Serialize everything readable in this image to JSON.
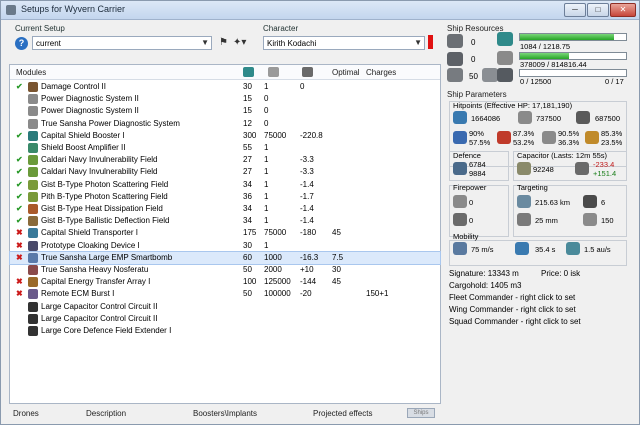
{
  "window": {
    "title": "Setups for Wyvern Carrier",
    "min": "─",
    "max": "□",
    "close": "✕"
  },
  "setup": {
    "label": "Current Setup",
    "value": "current"
  },
  "character": {
    "label": "Character",
    "value": "Kirith Kodachi"
  },
  "modules": {
    "headers": {
      "name": "Modules",
      "optimal": "Optimal",
      "charges": "Charges"
    },
    "rows": [
      {
        "state": "on",
        "name": "Damage Control II",
        "c1": "30",
        "c2": "1",
        "c3": "0",
        "c4": "",
        "c5": "",
        "icon": "#7a5530"
      },
      {
        "state": "",
        "name": "Power Diagnostic System II",
        "c1": "15",
        "c2": "0",
        "c3": "",
        "c4": "",
        "c5": "",
        "icon": "#8a8a8a"
      },
      {
        "state": "",
        "name": "Power Diagnostic System II",
        "c1": "15",
        "c2": "0",
        "c3": "",
        "c4": "",
        "c5": "",
        "icon": "#8a8a8a"
      },
      {
        "state": "",
        "name": "True Sansha Power Diagnostic System",
        "c1": "12",
        "c2": "0",
        "c3": "",
        "c4": "",
        "c5": "",
        "icon": "#8a8a8a"
      },
      {
        "state": "on",
        "name": "Capital Shield Booster I",
        "c1": "300",
        "c2": "75000",
        "c3": "-220.8",
        "c4": "",
        "c5": "",
        "icon": "#2a7a7a"
      },
      {
        "state": "",
        "name": "Shield Boost Amplifier II",
        "c1": "55",
        "c2": "1",
        "c3": "",
        "c4": "",
        "c5": "",
        "icon": "#3a8a6a"
      },
      {
        "state": "on",
        "name": "Caldari Navy Invulnerability Field",
        "c1": "27",
        "c2": "1",
        "c3": "-3.3",
        "c4": "",
        "c5": "",
        "icon": "#6a9a3a"
      },
      {
        "state": "on",
        "name": "Caldari Navy Invulnerability Field",
        "c1": "27",
        "c2": "1",
        "c3": "-3.3",
        "c4": "",
        "c5": "",
        "icon": "#6a9a3a"
      },
      {
        "state": "on",
        "name": "Gist B-Type Photon Scattering Field",
        "c1": "34",
        "c2": "1",
        "c3": "-1.4",
        "c4": "",
        "c5": "",
        "icon": "#7a9a3a"
      },
      {
        "state": "on",
        "name": "Pith B-Type Photon Scattering Field",
        "c1": "36",
        "c2": "1",
        "c3": "-1.7",
        "c4": "",
        "c5": "",
        "icon": "#7a9a3a"
      },
      {
        "state": "on",
        "name": "Gist B-Type Heat Dissipation Field",
        "c1": "34",
        "c2": "1",
        "c3": "-1.4",
        "c4": "",
        "c5": "",
        "icon": "#aa5a2a"
      },
      {
        "state": "on",
        "name": "Gist B-Type Ballistic Deflection Field",
        "c1": "34",
        "c2": "1",
        "c3": "-1.4",
        "c4": "",
        "c5": "",
        "icon": "#8a6a3a"
      },
      {
        "state": "off",
        "name": "Capital Shield Transporter I",
        "c1": "175",
        "c2": "75000",
        "c3": "-180",
        "c4": "45",
        "c5": "",
        "icon": "#3a7a9a"
      },
      {
        "state": "off",
        "name": "Prototype Cloaking Device I",
        "c1": "30",
        "c2": "1",
        "c3": "",
        "c4": "",
        "c5": "",
        "icon": "#4a4a6a"
      },
      {
        "state": "off",
        "name": "True Sansha Large EMP Smartbomb",
        "c1": "60",
        "c2": "1000",
        "c3": "-16.3",
        "c4": "7.5",
        "c5": "",
        "icon": "#5a7aaa",
        "selected": true
      },
      {
        "state": "",
        "name": "True Sansha Heavy Nosferatu",
        "c1": "50",
        "c2": "2000",
        "c3": "+10",
        "c4": "30",
        "c5": "",
        "icon": "#8a4a4a"
      },
      {
        "state": "off",
        "name": "Capital Energy Transfer Array I",
        "c1": "100",
        "c2": "125000",
        "c3": "-144",
        "c4": "45",
        "c5": "",
        "icon": "#9a6a2a"
      },
      {
        "state": "off",
        "name": "Remote ECM Burst I",
        "c1": "50",
        "c2": "100000",
        "c3": "-20",
        "c4": "",
        "c5": "150+1",
        "icon": "#6a5a8a"
      },
      {
        "state": "",
        "name": "Large Capacitor Control Circuit II",
        "c1": "",
        "c2": "",
        "c3": "",
        "c4": "",
        "c5": "",
        "icon": "#333333"
      },
      {
        "state": "",
        "name": "Large Capacitor Control Circuit II",
        "c1": "",
        "c2": "",
        "c3": "",
        "c4": "",
        "c5": "",
        "icon": "#333333"
      },
      {
        "state": "",
        "name": "Large Core Defence Field Extender I",
        "c1": "",
        "c2": "",
        "c3": "",
        "c4": "",
        "c5": "",
        "icon": "#333333"
      }
    ]
  },
  "bottom_tabs": {
    "drones": "Drones",
    "description": "Description",
    "boosters": "Boosters\\Implants",
    "projected": "Projected effects",
    "extra": "Ships"
  },
  "resources": {
    "title": "Ship Resources",
    "turrets": "0",
    "launchers": "0",
    "calibration": "50",
    "drone_count": "0",
    "cpu_text": "1084 / 1218.75",
    "cpu_fraction": 0.89,
    "pg_text": "378009 / 814816.44",
    "pg_fraction": 0.46,
    "drone_bay_text": "0 / 12500",
    "bandwidth_text": "0 / 17"
  },
  "params": {
    "title": "Ship Parameters",
    "hitpoints_label": "Hitpoints (Effective HP: 17,181,190)",
    "shield_hp": "1664086",
    "armor_hp": "737500",
    "hull_hp": "687500",
    "res": {
      "em_shield": "90%",
      "em_armor": "57.5%",
      "th_shield": "87.3%",
      "th_armor": "53.2%",
      "ki_shield": "90.5%",
      "ki_armor": "36.3%",
      "ex_shield": "85.3%",
      "ex_armor": "23.5%"
    },
    "defence_label": "Defence",
    "defence_a": "6784",
    "defence_b": "9884",
    "capacitor_label": "Capacitor (Lasts: 12m 55s)",
    "capacitor_amount": "92248",
    "cap_minus": "-233.4",
    "cap_plus": "+151.4",
    "firepower_label": "Firepower",
    "fp_a": "0",
    "fp_b": "0",
    "targeting_label": "Targeting",
    "target_range": "215.63 km",
    "target_count": "6",
    "sig_radius": "25 mm",
    "scan_res": "150",
    "mobility_label": "Mobility",
    "speed": "75 m/s",
    "align": "35.4 s",
    "warp": "1.5 au/s",
    "signature": "Signature: 13343 m",
    "price": "Price: 0 isk",
    "cargohold": "Cargohold: 1405 m3",
    "fleet_cmd": "Fleet Commander - right click to set",
    "wing_cmd": "Wing Commander - right click to set",
    "squad_cmd": "Squad Commander - right click to set"
  }
}
